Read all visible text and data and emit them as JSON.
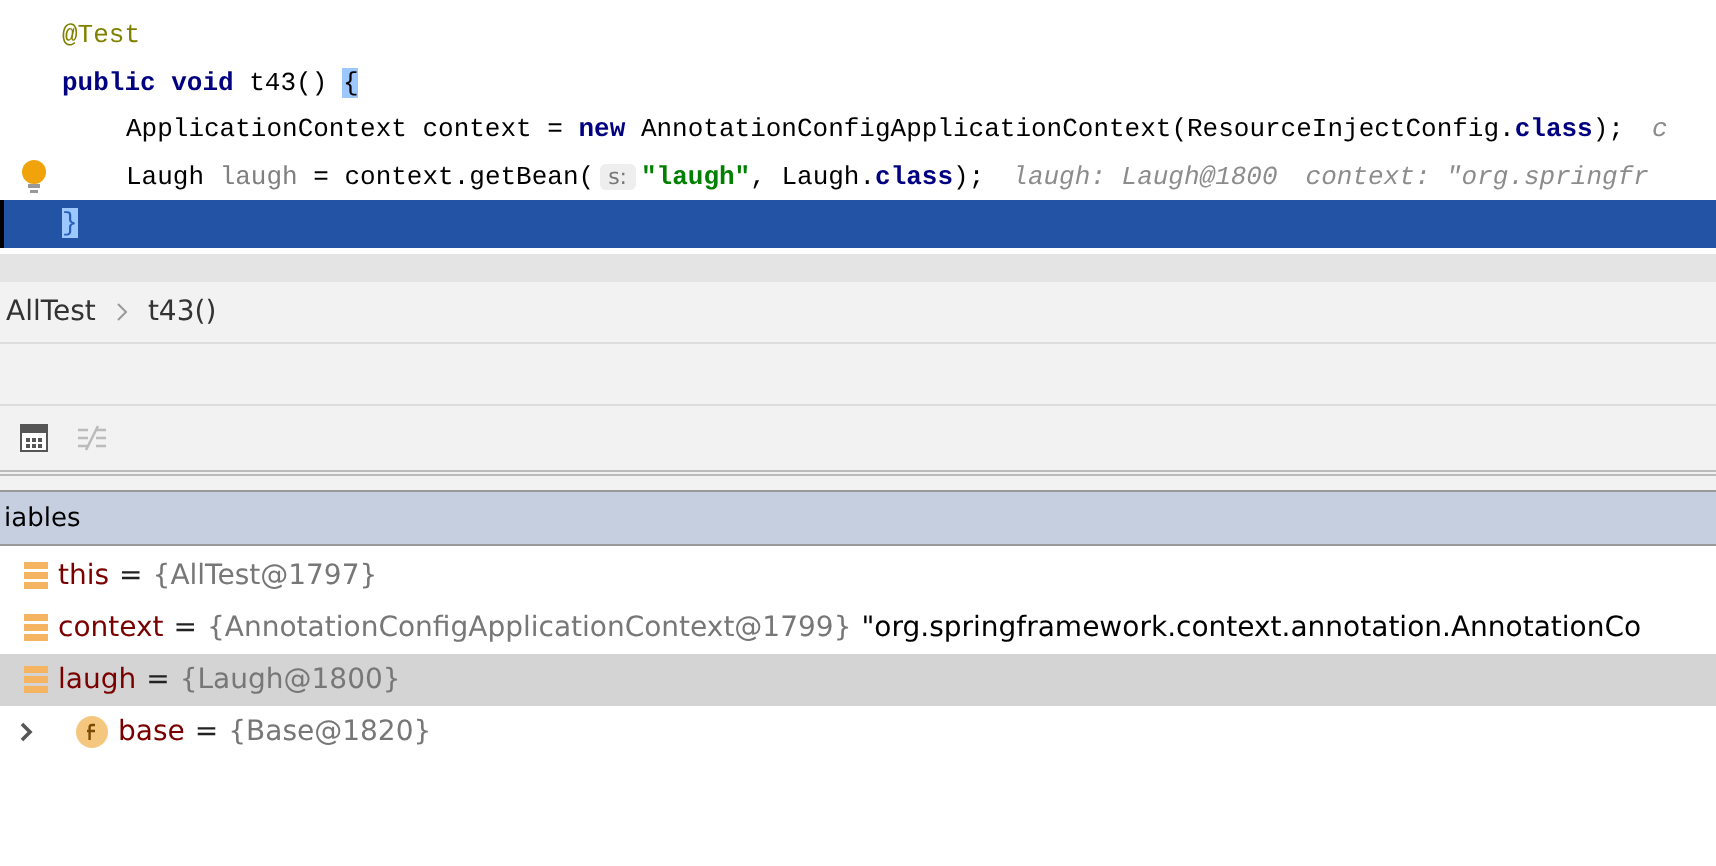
{
  "editor": {
    "lines": [
      {
        "kind": "header",
        "selected": false,
        "segments": [
          {
            "kind": "annotation",
            "text": "@Test"
          }
        ]
      },
      {
        "kind": "header",
        "selected": false,
        "segments": [
          {
            "kind": "keyword",
            "text": "public void"
          },
          {
            "kind": "plain",
            "text": " t43() "
          },
          {
            "kind": "brace",
            "text": "{"
          }
        ]
      },
      {
        "kind": "body",
        "selected": false,
        "segments": [
          {
            "kind": "plain",
            "text": "ApplicationContext context = "
          },
          {
            "kind": "keyword",
            "text": "new"
          },
          {
            "kind": "plain",
            "text": " AnnotationConfigApplicationContext(ResourceInjectConfig."
          },
          {
            "kind": "keyword",
            "text": "class"
          },
          {
            "kind": "plain",
            "text": ");"
          },
          {
            "kind": "hint",
            "text": "c"
          }
        ]
      },
      {
        "kind": "body",
        "selected": false,
        "bulb": true,
        "segments": [
          {
            "kind": "plain",
            "text": "Laugh "
          },
          {
            "kind": "unused",
            "text": "laugh"
          },
          {
            "kind": "plain",
            "text": " = context.getBean("
          },
          {
            "kind": "param",
            "text": "s:"
          },
          {
            "kind": "string",
            "text": "\"laugh\""
          },
          {
            "kind": "plain",
            "text": ", Laugh."
          },
          {
            "kind": "keyword",
            "text": "class"
          },
          {
            "kind": "plain",
            "text": ");"
          },
          {
            "kind": "hint",
            "text": "laugh: Laugh@1800"
          },
          {
            "kind": "hint",
            "text": "context: \"org.springfr"
          }
        ]
      },
      {
        "kind": "header",
        "selected": true,
        "segments": [
          {
            "kind": "brace",
            "text": "}"
          }
        ]
      }
    ]
  },
  "breadcrumb": [
    "AllTest",
    "t43()"
  ],
  "variables_panel": {
    "title": "iables",
    "rows": [
      {
        "kind": "local",
        "name": "this",
        "eq": "=",
        "value": "{AllTest@1797}",
        "selected": false
      },
      {
        "kind": "local",
        "name": "context",
        "eq": "=",
        "value": "{AnnotationConfigApplicationContext@1799}",
        "extra": "\"org.springframework.context.annotation.AnnotationCo",
        "selected": false
      },
      {
        "kind": "local",
        "name": "laugh",
        "eq": "=",
        "value": "{Laugh@1800}",
        "selected": true,
        "children": [
          {
            "kind": "field",
            "name": "base",
            "eq": "=",
            "value": "{Base@1820}",
            "selected": false,
            "expanded": false
          }
        ]
      }
    ]
  }
}
